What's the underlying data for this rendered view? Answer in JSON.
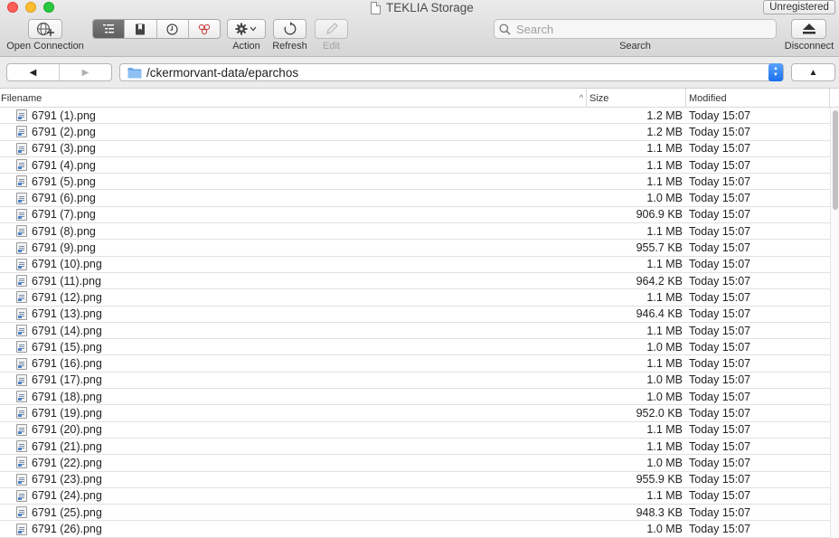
{
  "window": {
    "title": "TEKLIA Storage",
    "registration": "Unregistered"
  },
  "toolbar": {
    "open_connection": "Open Connection",
    "action": "Action",
    "refresh": "Refresh",
    "edit": "Edit",
    "search_label": "Search",
    "search_placeholder": "Search",
    "disconnect": "Disconnect"
  },
  "navigation": {
    "back_glyph": "◀",
    "forward_glyph": "▶",
    "path": "/ckermorvant-data/eparchos",
    "up_glyph": "▲"
  },
  "table": {
    "columns": [
      "Filename",
      "Size",
      "Modified"
    ],
    "sort_glyph": "^",
    "rows": [
      {
        "name": "6791 (1).png",
        "size": "1.2 MB",
        "modified": "Today 15:07"
      },
      {
        "name": "6791 (2).png",
        "size": "1.2 MB",
        "modified": "Today 15:07"
      },
      {
        "name": "6791 (3).png",
        "size": "1.1 MB",
        "modified": "Today 15:07"
      },
      {
        "name": "6791 (4).png",
        "size": "1.1 MB",
        "modified": "Today 15:07"
      },
      {
        "name": "6791 (5).png",
        "size": "1.1 MB",
        "modified": "Today 15:07"
      },
      {
        "name": "6791 (6).png",
        "size": "1.0 MB",
        "modified": "Today 15:07"
      },
      {
        "name": "6791 (7).png",
        "size": "906.9 KB",
        "modified": "Today 15:07"
      },
      {
        "name": "6791 (8).png",
        "size": "1.1 MB",
        "modified": "Today 15:07"
      },
      {
        "name": "6791 (9).png",
        "size": "955.7 KB",
        "modified": "Today 15:07"
      },
      {
        "name": "6791 (10).png",
        "size": "1.1 MB",
        "modified": "Today 15:07"
      },
      {
        "name": "6791 (11).png",
        "size": "964.2 KB",
        "modified": "Today 15:07"
      },
      {
        "name": "6791 (12).png",
        "size": "1.1 MB",
        "modified": "Today 15:07"
      },
      {
        "name": "6791 (13).png",
        "size": "946.4 KB",
        "modified": "Today 15:07"
      },
      {
        "name": "6791 (14).png",
        "size": "1.1 MB",
        "modified": "Today 15:07"
      },
      {
        "name": "6791 (15).png",
        "size": "1.0 MB",
        "modified": "Today 15:07"
      },
      {
        "name": "6791 (16).png",
        "size": "1.1 MB",
        "modified": "Today 15:07"
      },
      {
        "name": "6791 (17).png",
        "size": "1.0 MB",
        "modified": "Today 15:07"
      },
      {
        "name": "6791 (18).png",
        "size": "1.0 MB",
        "modified": "Today 15:07"
      },
      {
        "name": "6791 (19).png",
        "size": "952.0 KB",
        "modified": "Today 15:07"
      },
      {
        "name": "6791 (20).png",
        "size": "1.1 MB",
        "modified": "Today 15:07"
      },
      {
        "name": "6791 (21).png",
        "size": "1.1 MB",
        "modified": "Today 15:07"
      },
      {
        "name": "6791 (22).png",
        "size": "1.0 MB",
        "modified": "Today 15:07"
      },
      {
        "name": "6791 (23).png",
        "size": "955.9 KB",
        "modified": "Today 15:07"
      },
      {
        "name": "6791 (24).png",
        "size": "1.1 MB",
        "modified": "Today 15:07"
      },
      {
        "name": "6791 (25).png",
        "size": "948.3 KB",
        "modified": "Today 15:07"
      },
      {
        "name": "6791 (26).png",
        "size": "1.0 MB",
        "modified": "Today 15:07"
      }
    ]
  },
  "icons": {
    "folder": "folder-icon",
    "file": "png-file-icon"
  },
  "colors": {
    "accent": "#1a6fee",
    "folder": "#6aa8e8"
  }
}
